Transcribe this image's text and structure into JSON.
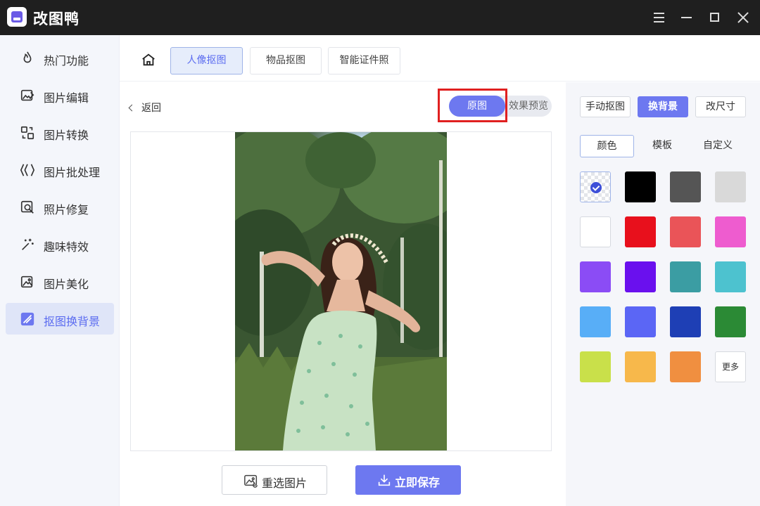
{
  "window": {
    "title": "改图鸭"
  },
  "sidebar": {
    "items": [
      {
        "label": "热门功能",
        "icon": "flame-icon"
      },
      {
        "label": "图片编辑",
        "icon": "image-edit-icon"
      },
      {
        "label": "图片转换",
        "icon": "convert-icon"
      },
      {
        "label": "图片批处理",
        "icon": "batch-icon"
      },
      {
        "label": "照片修复",
        "icon": "photo-repair-icon"
      },
      {
        "label": "趣味特效",
        "icon": "magic-wand-icon"
      },
      {
        "label": "图片美化",
        "icon": "image-beautify-icon"
      },
      {
        "label": "抠图换背景",
        "icon": "cutout-icon",
        "active": true
      }
    ]
  },
  "tabs": [
    {
      "label": "人像抠图",
      "active": true
    },
    {
      "label": "物品抠图"
    },
    {
      "label": "智能证件照"
    }
  ],
  "main": {
    "back_label": "返回",
    "toggle": {
      "original": "原图",
      "preview": "效果预览",
      "selected": "原图"
    },
    "reselect_label": "重选图片",
    "save_label": "立即保存"
  },
  "panel": {
    "modes": [
      {
        "label": "手动抠图"
      },
      {
        "label": "换背景",
        "active": true
      },
      {
        "label": "改尺寸"
      }
    ],
    "sub_tabs": [
      {
        "label": "颜色",
        "active": true
      },
      {
        "label": "模板"
      },
      {
        "label": "自定义"
      }
    ],
    "swatches": [
      {
        "color": "transparent",
        "selected": true
      },
      {
        "color": "#000000"
      },
      {
        "color": "#555555"
      },
      {
        "color": "#d9d9d9"
      },
      {
        "color": "#ffffff"
      },
      {
        "color": "#e8101c"
      },
      {
        "color": "#ea5458"
      },
      {
        "color": "#ee5ccf"
      },
      {
        "color": "#8b4cf5"
      },
      {
        "color": "#6a10ee"
      },
      {
        "color": "#3b9da3"
      },
      {
        "color": "#4dc2cf"
      },
      {
        "color": "#58aef7"
      },
      {
        "color": "#5b66f5"
      },
      {
        "color": "#1e3fb5"
      },
      {
        "color": "#2b8a35"
      },
      {
        "color": "#c9e04a"
      },
      {
        "color": "#f7b84b"
      },
      {
        "color": "#f08f40"
      }
    ],
    "more_label": "更多"
  }
}
